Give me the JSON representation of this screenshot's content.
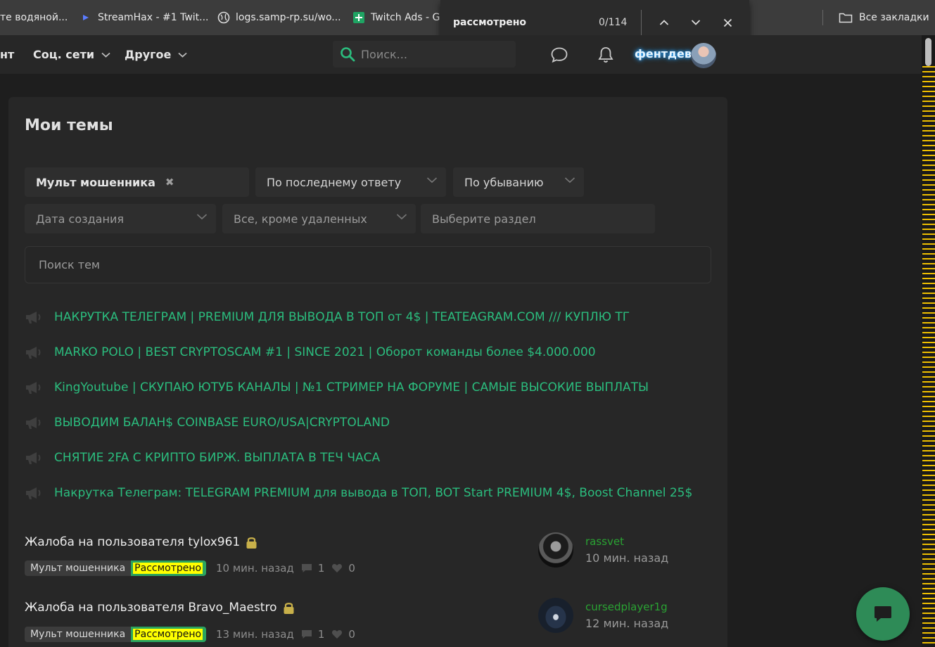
{
  "bookmarks": [
    {
      "label": "те водяной...",
      "icon": "none"
    },
    {
      "label": "StreamHax - #1 Twit...",
      "icon": "streamhax-icon"
    },
    {
      "label": "logs.samp-rp.su/wo...",
      "icon": "globe-icon"
    },
    {
      "label": "Twitch Ads - G",
      "icon": "google-sheets-icon"
    }
  ],
  "bookmarks_all": "Все закладки",
  "find": {
    "query": "рассмотрено",
    "count": "0/114"
  },
  "header": {
    "nav_partial": "нт",
    "nav_social": "Соц. сети",
    "nav_other": "Другое",
    "search_placeholder": "Поиск...",
    "username": "фентдев"
  },
  "main": {
    "title": "Мои темы",
    "filters": {
      "prefix": "Мульт мошенника",
      "sort": "По последнему ответу",
      "order": "По убыванию",
      "date": "Дата создания",
      "state": "Все, кроме удаленных",
      "section": "Выберите раздел"
    },
    "topic_search_placeholder": "Поиск тем"
  },
  "sticky_threads": [
    "НАКРУТКА ТЕЛЕГРАМ | PREMIUM ДЛЯ ВЫВОДА В ТОП от 4$ | TEATEAGRAM.COM /// КУПЛЮ ТГ",
    "MARKO POLO | BEST CRYPTOSCAM #1 | SINCE 2021 | Оборот команды более $4.000.000",
    "KingYoutube | СКУПАЮ ЮТУБ КАНАЛЫ | №1 СТРИМЕР НА ФОРУМЕ | САМЫЕ ВЫСОКИЕ ВЫПЛАТЫ",
    "ВЫВОДИМ БАЛАН$ COINBASE EURO/USA|CRYPTOLAND",
    "СНЯТИЕ 2FA С КРИПТО БИРЖ. ВЫПЛАТА В ТЕЧ ЧАСА",
    "Накрутка Телеграм: TELEGRAM PREMIUM для вывода в ТОП, BOT Start PREMIUM 4$, Boost Channel 25$"
  ],
  "threads": [
    {
      "title": "Жалоба на пользователя tylox961",
      "prefix": "Мульт мошенника",
      "status": "Рассмотрено",
      "time": "10 мин. назад",
      "replies": "1",
      "likes": "0",
      "last_user": "rassvet",
      "last_time": "10 мин. назад"
    },
    {
      "title": "Жалоба на пользователя Bravo_Maestro",
      "prefix": "Мульт мошенника",
      "status": "Рассмотрено",
      "time": "13 мин. назад",
      "replies": "1",
      "likes": "0",
      "last_user": "cursedplayer1g",
      "last_time": "12 мин. назад"
    }
  ],
  "colors": {
    "accent": "#2bbd7e",
    "status_bg": "#ffff00",
    "prefix_green": "#2aa35f",
    "fab": "#2e8b57"
  }
}
